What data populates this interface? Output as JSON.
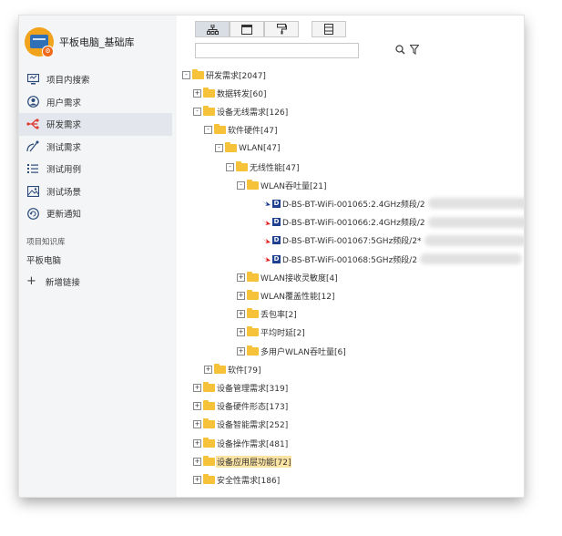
{
  "project": {
    "title": "平板电脑_基础库",
    "badge": "⚙"
  },
  "nav": [
    {
      "id": "search",
      "label": "项目内搜索",
      "icon": "monitor-icon"
    },
    {
      "id": "users",
      "label": "用户需求",
      "icon": "user-icon"
    },
    {
      "id": "dev",
      "label": "研发需求",
      "icon": "branch-icon",
      "active": true
    },
    {
      "id": "test-req",
      "label": "测试需求",
      "icon": "satellite-icon"
    },
    {
      "id": "test-case",
      "label": "测试用例",
      "icon": "list-icon"
    },
    {
      "id": "test-scene",
      "label": "测试场景",
      "icon": "image-icon"
    },
    {
      "id": "notify",
      "label": "更新通知",
      "icon": "refresh-icon"
    }
  ],
  "knowledge": {
    "section": "项目知识库",
    "item": "平板电脑",
    "add": "新增链接"
  },
  "tree": [
    {
      "label": "研发需求[2047]",
      "exp": "-"
    },
    {
      "label": "数据转发[60]",
      "exp": "+"
    },
    {
      "label": "设备无线需求[126]",
      "exp": "-"
    },
    {
      "label": "软件硬件[47]",
      "exp": "-"
    },
    {
      "label": "WLAN[47]",
      "exp": "-"
    },
    {
      "label": "无线性能[47]",
      "exp": "-"
    },
    {
      "label": "WLAN吞吐量[21]",
      "exp": "-"
    },
    {
      "label": "D-BS-BT-WiFi-001065:2.4GHz频段/2",
      "arrow": "blue"
    },
    {
      "label": "D-BS-BT-WiFi-001066:2.4GHz频段/2",
      "arrow": "red"
    },
    {
      "label": "D-BS-BT-WiFi-001067:5GHz频段/2*",
      "arrow": "red"
    },
    {
      "label": "D-BS-BT-WiFi-001068:5GHz频段/2",
      "arrow": "red"
    },
    {
      "label": "WLAN接收灵敏度[4]",
      "exp": "+"
    },
    {
      "label": "WLAN覆盖性能[12]",
      "exp": "+"
    },
    {
      "label": "丢包率[2]",
      "exp": "+"
    },
    {
      "label": "平均时延[2]",
      "exp": "+"
    },
    {
      "label": "多用户WLAN吞吐量[6]",
      "exp": "+"
    },
    {
      "label": "软件[79]",
      "exp": "+"
    },
    {
      "label": "设备管理需求[319]",
      "exp": "+"
    },
    {
      "label": "设备硬件形态[173]",
      "exp": "+"
    },
    {
      "label": "设备智能需求[252]",
      "exp": "+"
    },
    {
      "label": "设备操作需求[481]",
      "exp": "+"
    },
    {
      "label": "设备应用层功能[72]",
      "exp": "+",
      "selected": true
    },
    {
      "label": "安全性需求[186]",
      "exp": "+"
    }
  ]
}
